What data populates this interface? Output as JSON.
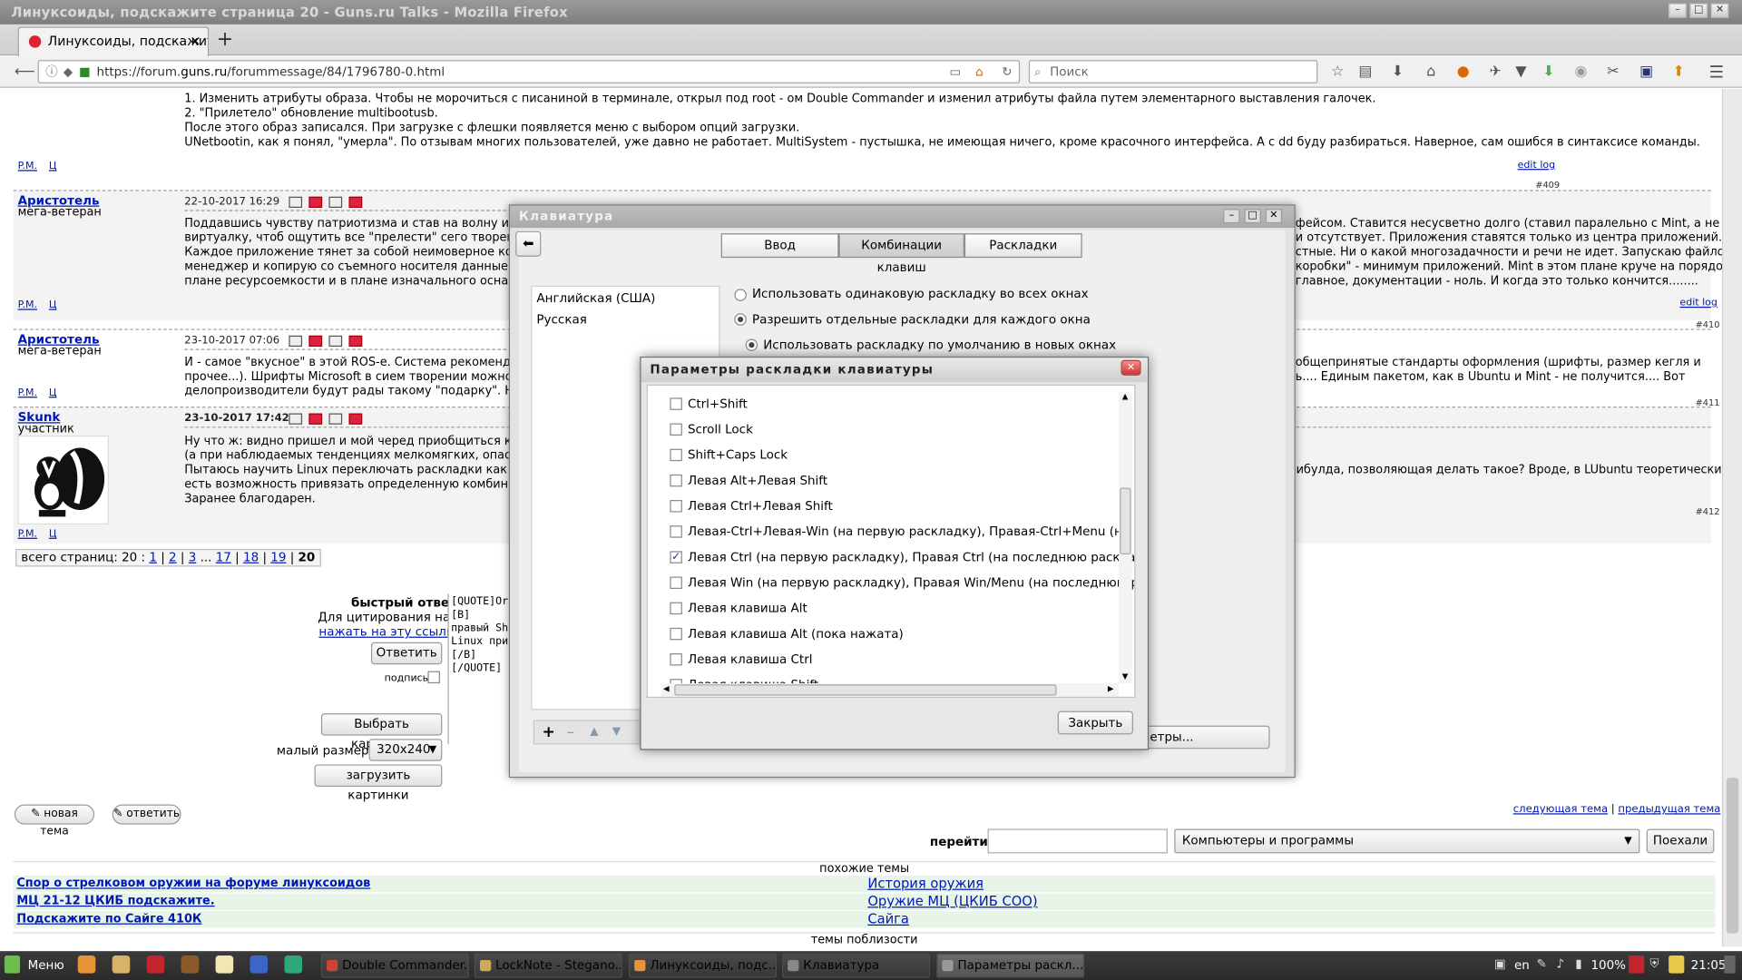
{
  "window": {
    "title": "Линуксоиды, подскажите страница 20 - Guns.ru Talks - Mozilla Firefox"
  },
  "browser": {
    "tab_title": "Линуксоиды, подскажите",
    "tab_close": "×",
    "new_tab": "+",
    "url_prefix": "https://forum.",
    "url_host": "guns.ru",
    "url_rest": "/forummessage/84/1796780-0.html",
    "search_placeholder": "Поиск"
  },
  "posts": {
    "top_lines": [
      "1. Изменить атрибуты образа. Чтобы не морочиться с писаниной в терминале, открыл под root - ом Double Commander и изменил атрибуты файла путем элементарного выставления галочек.",
      "2. \"Прилетело\" обновление multibootusb.",
      "После этого образ записался. При загрузке с флешки появляется меню с выбором опций загрузки.",
      "UNetbootin, как я понял, \"умерла\". По отзывам многих пользователей, уже давно не работает. MultiSystem - пустышка, не имеющая ничего, кроме красочного интерфейса. А с dd буду разбираться. Наверное, сам ошибся в синтаксисе команды."
    ],
    "pm": "P.M.",
    "q": "Ц",
    "edit_log": "edit log",
    "num_409": "#409",
    "num_410": "#410",
    "num_411": "#411",
    "num_412": "#412",
    "p1": {
      "author": "Аристотель",
      "rank": "мега-ветеран",
      "date": "22-10-2017 16:29",
      "lines_left": [
        "Поддавшись чувству патриотизма и став на волну импорт",
        "виртуалку, чтоб ощутить все \"прелести\" сего творения). П",
        "Каждое приложение тянет за собой неимоверное количест",
        "менеджер и копирую со съемного носителя данные на од",
        "плане ресурсоемкости и в плане изначального оснащения"
      ],
      "lines_right": [
        "фейсом. Ставится несусветно долго (ставил паралельно с Mint, а не на",
        "и отсутствует. Приложения ставятся только из центра приложений.",
        "стные. Ни о какой многозадачности и речи не идет. Запускаю файловый",
        "коробки\" - минимум приложений. Mint в этом плане круче на порядок и в",
        "главное, документации - ноль. И когда это только кончится........"
      ]
    },
    "p2": {
      "author": "Аристотель",
      "rank": "мега-ветеран",
      "date": "23-10-2017 07:06",
      "lines_left": [
        "И - самое \"вкусное\" в этой ROS-е. Система рекомендован",
        "прочее...). Шрифты Microsoft в сием творении можно пост",
        "делопроизводители будут рады такому \"подарку\". На пре"
      ],
      "lines_right": [
        "общепринятые стандарты оформления (шрифты, размер кегля и",
        "ь.... Единым пакетом, как в Ubuntu и Mint - не получится.... Вот"
      ]
    },
    "p3": {
      "author": "Skunk",
      "rank": "участник",
      "date": "23-10-2017 17:42",
      "lines_left": [
        "Ну что ж: видно пришел и мой черед приобщиться к прекр",
        "(а при наблюдаемых тенденциях мелкомягких, опасаюсь,",
        "Пытаюсь научить Linux переключать раскладки как я при",
        "есть возможность привязать определенную комбинацию к",
        "Заранее благодарен."
      ],
      "lines_right": [
        "рибулда, позволяющая делать такое? Вроде, в LUbuntu теоретически"
      ]
    }
  },
  "pagination": {
    "label": "всего страниц: 20 :",
    "pages": [
      "1",
      "2",
      "3",
      "...",
      "17",
      "18",
      "19",
      "20"
    ]
  },
  "reply": {
    "title": "быстрый ответ",
    "quote_hint": "Для цитирования надо",
    "quote_link": "нажать на эту ссылку",
    "reply_btn": "Ответить",
    "sign": "подпись",
    "pick_images": "Выбрать картинки",
    "small_size_label": "малый размер :",
    "small_size_value": "320x240",
    "upload_images": "загрузить картинки",
    "text_lines": [
      "[QUOTE]Or",
      "[B]",
      "правый Sh",
      "Linux при",
      "[/B]",
      "[/QUOTE]"
    ]
  },
  "footer": {
    "new_topic": "новая тема",
    "answer": "ответить",
    "next_topic": "следующая тема",
    "sep": "|",
    "prev_topic": "предыдущая тема",
    "goto_label": "перейти:",
    "forum_select": "Компьютеры и программы",
    "go_btn": "Поехали",
    "similar": "похожие темы",
    "similar_left": [
      "Спор о стрелковом оружии на форуме линуксоидов",
      "МЦ 21-12 ЦКИБ подскажите.",
      "Подскажите по Сайге 410К"
    ],
    "similar_right": [
      "История оружия",
      "Оружие МЦ (ЦКИБ СОО)",
      "Сайга"
    ],
    "near": "темы поблизости"
  },
  "keyboard_dialog": {
    "title": "Клавиатура",
    "tabs": [
      "Ввод",
      "Комбинации клавиш",
      "Раскладки"
    ],
    "languages": [
      "Английская (США)",
      "Русская"
    ],
    "radio1": "Использовать одинаковую раскладку во всех окнах",
    "radio2": "Разрешить отдельные раскладки для каждого окна",
    "radio3": "Использовать раскладку по умолчанию в новых окнах",
    "params_btn": "етры...",
    "toolbar": [
      "+",
      "–",
      "▲",
      "▼"
    ]
  },
  "layout_dialog": {
    "title": "Параметры раскладки клавиатуры",
    "options": [
      {
        "label": "Ctrl+Shift",
        "checked": false
      },
      {
        "label": "Scroll Lock",
        "checked": false
      },
      {
        "label": "Shift+Caps Lock",
        "checked": false
      },
      {
        "label": "Левая Alt+Левая Shift",
        "checked": false
      },
      {
        "label": "Левая Ctrl+Левая Shift",
        "checked": false
      },
      {
        "label": "Левая-Ctrl+Левая-Win (на первую раскладку), Правая-Ctrl+Menu (на вторую раск",
        "checked": false
      },
      {
        "label": "Левая Ctrl (на первую раскладку), Правая Ctrl (на последнюю раскладку)",
        "checked": true
      },
      {
        "label": "Левая Win (на первую раскладку), Правая Win/Menu (на последнюю раскладку)",
        "checked": false
      },
      {
        "label": "Левая клавиша Alt",
        "checked": false
      },
      {
        "label": "Левая клавиша Alt (пока нажата)",
        "checked": false
      },
      {
        "label": "Левая клавиша Ctrl",
        "checked": false
      },
      {
        "label": "Левая клавиша Shift",
        "checked": false
      }
    ],
    "close_btn": "Закрыть"
  },
  "taskbar": {
    "menu": "Меню",
    "tasks": [
      "Double Commander...",
      "LockNote - Stegano...",
      "Линуксоиды, подс...",
      "Клавиатура",
      "Параметры раскл..."
    ],
    "lang": "en",
    "battery": "100%",
    "clock": "21:05"
  }
}
